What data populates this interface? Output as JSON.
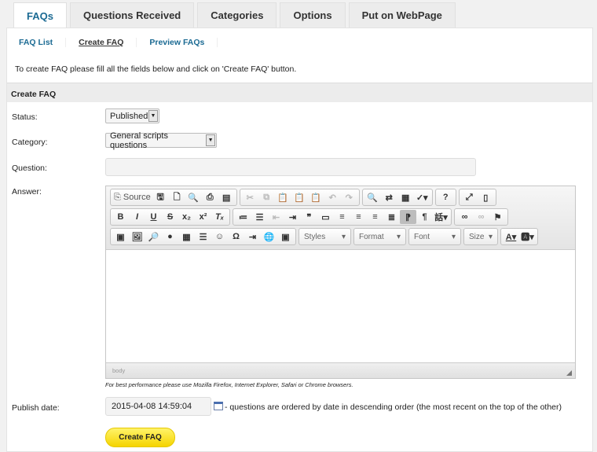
{
  "tabs": [
    "FAQs",
    "Questions Received",
    "Categories",
    "Options",
    "Put on WebPage"
  ],
  "subnav": [
    "FAQ List",
    "Create FAQ",
    "Preview FAQs"
  ],
  "instruction": "To create FAQ please fill all the fields below and click on 'Create FAQ' button.",
  "section_title": "Create FAQ",
  "form": {
    "status_label": "Status:",
    "status_value": "Published",
    "category_label": "Category:",
    "category_value": "General scripts questions",
    "question_label": "Question:",
    "question_value": "",
    "answer_label": "Answer:",
    "publish_label": "Publish date:",
    "publish_value": "2015-04-08 14:59:04",
    "publish_desc": "- questions are ordered by date in descending order (the most recent on the top of the other)",
    "browser_note": "For best performance please use Mozilla Firefox, Internet Explorer, Safari or Chrome browsers.",
    "submit": "Create FAQ"
  },
  "editor": {
    "source_label": "Source",
    "styles": "Styles",
    "format": "Format",
    "font": "Font",
    "size": "Size",
    "path": "body"
  },
  "colors": {
    "accent": "#1b6a93",
    "button": "#f5d400"
  }
}
